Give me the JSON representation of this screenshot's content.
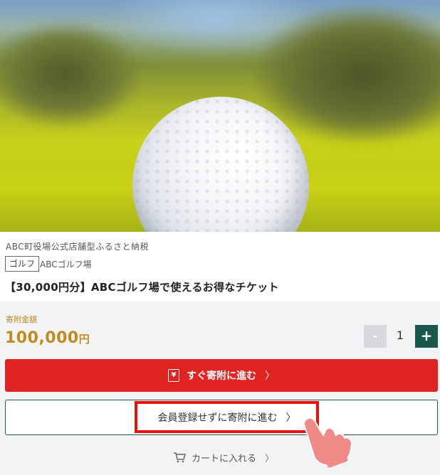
{
  "hero": {
    "image_alt": "golf ball on grass"
  },
  "product": {
    "shop": "ABC町役場公式店舗型ふるさと納税",
    "tag": "ゴルフ",
    "place": "ABCゴルフ場",
    "title": "【30,000円分】ABCゴルフ場で使えるお得なチケット"
  },
  "donation": {
    "label": "寄附金額",
    "amount": "100,000",
    "unit": "円"
  },
  "quantity": {
    "minus": "-",
    "value": "1",
    "plus": "+"
  },
  "buttons": {
    "donate_icon": "¥",
    "donate_label": "すぐ寄附に進む",
    "guest_label": "会員登録せずに寄附に進む",
    "chevron": "〉",
    "cart_label": "カートに入れる"
  },
  "colors": {
    "primary_red": "#df2421",
    "primary_green": "#17584a",
    "amount_gold": "#c28a1e",
    "highlight_red": "#ee0f0f"
  }
}
